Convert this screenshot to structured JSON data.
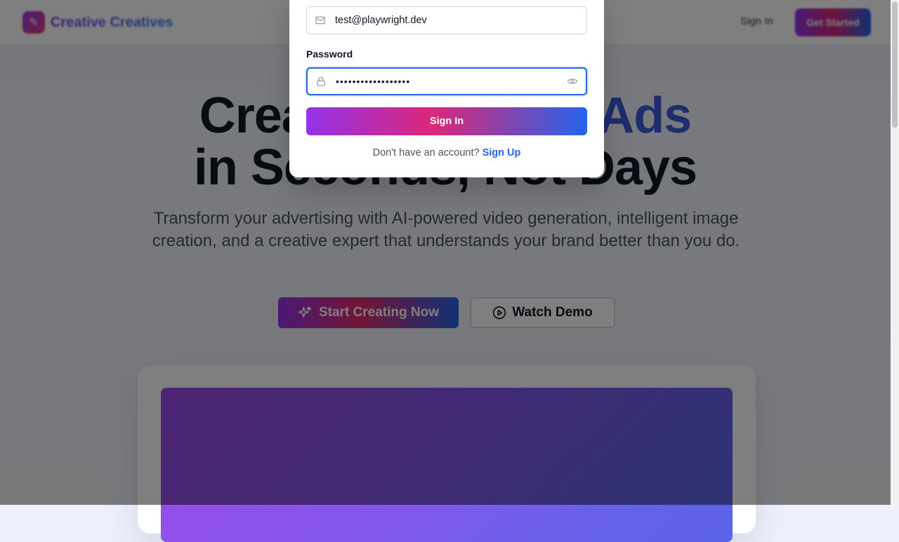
{
  "navbar": {
    "brand_name": "Creative Creatives",
    "signin_label": "Sign In",
    "cta_label": "Get Started"
  },
  "hero": {
    "title_line1_start": "Create",
    "title_line1_accent": "Ads",
    "title_line2": "in Seconds, Not Days",
    "subtitle": "Transform your advertising with AI-powered video generation, intelligent image creation, and a creative expert that understands your brand better than you do.",
    "primary_button": "Start Creating Now",
    "secondary_button": "Watch Demo"
  },
  "modal": {
    "email_value": "test@playwright.dev",
    "password_label": "Password",
    "password_value": "••••••••••••••••••",
    "submit_label": "Sign In",
    "switch_text": "Don't have an account?",
    "switch_link": "Sign Up"
  },
  "colors": {
    "accent": "#3b5bdb",
    "gradient_start": "#9333ea",
    "gradient_mid": "#db2777",
    "gradient_end": "#2563eb",
    "link": "#2563eb"
  },
  "icons": {
    "email": "mail-icon",
    "password": "lock-icon",
    "toggle": "eye-icon",
    "primary": "sparkles-icon",
    "secondary": "play-circle-icon"
  }
}
